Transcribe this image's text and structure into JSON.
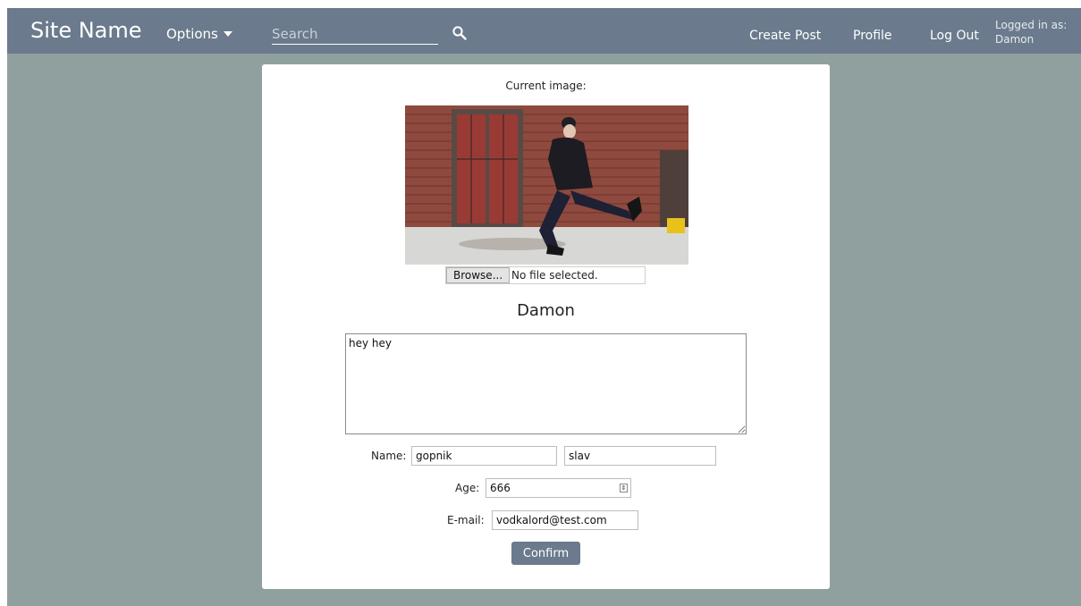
{
  "header": {
    "site_name": "Site Name",
    "options_label": "Options",
    "search_placeholder": "Search",
    "create_post": "Create Post",
    "profile": "Profile",
    "log_out": "Log Out",
    "logged_in_label": "Logged in as:",
    "logged_in_user": "Damon"
  },
  "profile_form": {
    "current_image_label": "Current image:",
    "browse_label": "Browse...",
    "file_status": "No file selected.",
    "username": "Damon",
    "bio": "hey hey",
    "name_label": "Name:",
    "first_name": "gopnik",
    "last_name": "slav",
    "age_label": "Age:",
    "age": "666",
    "email_label": "E-mail:",
    "email": "vodkalord@test.com",
    "confirm_label": "Confirm"
  },
  "colors": {
    "navbar": "#6b7a8c",
    "page_background": "#8fa09f",
    "card": "#ffffff",
    "button": "#6b7a8c"
  },
  "icons": [
    "chevron-down-icon",
    "search-icon",
    "spinner-arrows-icon",
    "resize-grip-icon"
  ]
}
